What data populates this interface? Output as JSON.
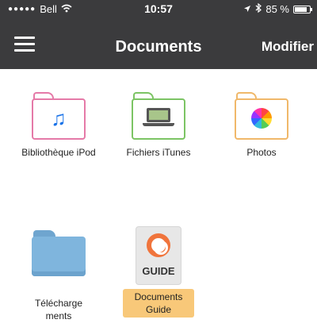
{
  "status_bar": {
    "signal": "●●●●●",
    "carrier": "Bell",
    "wifi_icon": "wifi-icon",
    "time": "10:57",
    "location_icon": "location-arrow-icon",
    "bluetooth_icon": "bluetooth-icon",
    "battery_text": "85 %",
    "battery_level": 0.85
  },
  "navbar": {
    "menu_icon": "hamburger-icon",
    "title": "Documents",
    "action": "Modifier"
  },
  "items": [
    {
      "label": "Bibliothèque iPod",
      "icon": "music-folder-icon",
      "color": "#e57aa8"
    },
    {
      "label": "Fichiers iTunes",
      "icon": "laptop-folder-icon",
      "color": "#7cc464"
    },
    {
      "label": "Photos",
      "icon": "photos-folder-icon",
      "color": "#f0b86a"
    },
    {
      "label": "Téléchargements",
      "icon": "downloads-folder-icon",
      "color": "#7fb5dd"
    },
    {
      "label": "Documents Guide",
      "icon": "guide-icon",
      "icon_text": "GUIDE",
      "selected": true
    }
  ],
  "colors": {
    "navbar_bg": "#3b3b3d",
    "selection": "#f8c879"
  }
}
